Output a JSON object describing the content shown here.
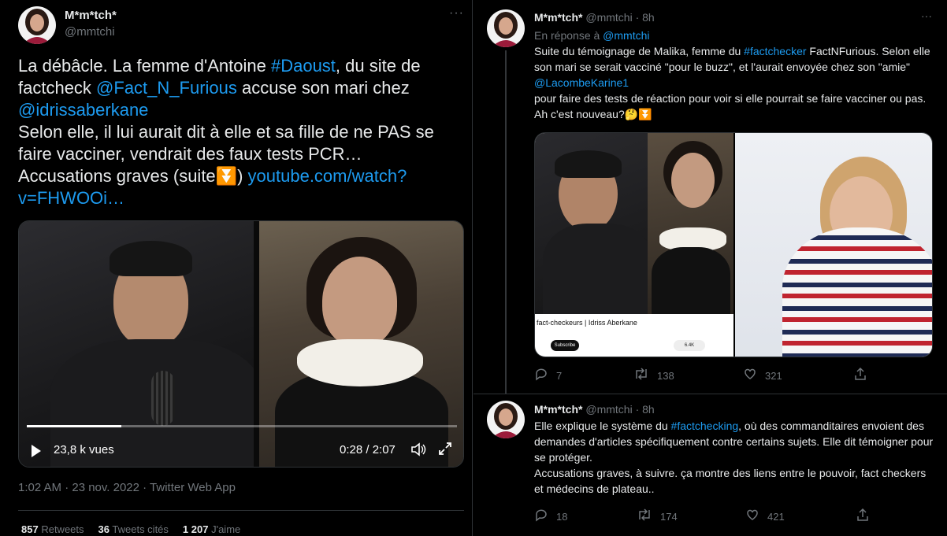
{
  "left_tweet": {
    "author_name": "M*m*tch*",
    "author_handle": "@mmtchi",
    "text_parts": {
      "p1": "La débâcle. La femme d'Antoine ",
      "tag_daoust": "#Daoust",
      "p2": ", du site de factcheck ",
      "mention_fnf": "@Fact_N_Furious",
      "p3": " accuse son mari chez ",
      "mention_idriss": "@idrissaberkane",
      "p4": "Selon elle, il lui aurait dit à elle et sa fille de ne PAS se faire vacciner, vendrait des faux tests PCR… Accusations graves (suite",
      "emoji": "⏬",
      "p5": ") ",
      "link": "youtube.com/watch?v=FHWOOi…"
    },
    "video": {
      "views": "23,8 k vues",
      "time": "0:28 / 2:07",
      "progress": 0.22
    },
    "meta": "1:02 AM · 23 nov. 2022 · Twitter Web App",
    "stats": {
      "retweets_count": "857",
      "retweets_label": "Retweets",
      "quotes_count": "36",
      "quotes_label": "Tweets cités",
      "likes_count": "1 207",
      "likes_label": "J'aime"
    }
  },
  "right_tweets": [
    {
      "author_name": "M*m*tch*",
      "author_handle": "@mmtchi",
      "time": "· 8h",
      "reply_to_label": "En réponse à ",
      "reply_to_handle": "@mmtchi",
      "text_parts": {
        "p1": "Suite du témoignage de Malika, femme du ",
        "tag": "#factchecker",
        "p2": " FactNFurious. Selon elle son mari se serait vacciné \"pour le buzz\", et l'aurait envoyée chez son \"amie\" ",
        "mention": "@LacombeKarine1",
        "p3": "pour faire des tests de réaction pour voir si elle pourrait se faire vacciner ou pas. Ah c'est nouveau?🤔⏬"
      },
      "media_caption": "fact-checkeurs | Idriss Aberkane",
      "media_subscribe": "Subscribe",
      "media_likes": "6.4K",
      "replies": "7",
      "retweets": "138",
      "likes": "321"
    },
    {
      "author_name": "M*m*tch*",
      "author_handle": "@mmtchi",
      "time": "· 8h",
      "text_parts": {
        "p1": "Elle explique le système du ",
        "tag": "#factchecking",
        "p2": ", où des commanditaires envoient des demandes d'articles spécifiquement contre certains sujets. Elle dit témoigner pour se protéger.",
        "p3": "Accusations graves, à suivre. ça montre des liens entre le pouvoir, fact checkers et médecins de plateau.."
      },
      "replies": "18",
      "retweets": "174",
      "likes": "421"
    }
  ],
  "icons": {
    "more": "···",
    "reply": "◯",
    "retweet": "⇄",
    "like": "♡",
    "share": "⇪",
    "play": "▶",
    "volume": "🔈",
    "fullscreen": "⤢"
  },
  "colors": {
    "accent": "#1d9bf0",
    "background": "#000000",
    "text": "#e7e9ea",
    "muted": "#71767b"
  }
}
